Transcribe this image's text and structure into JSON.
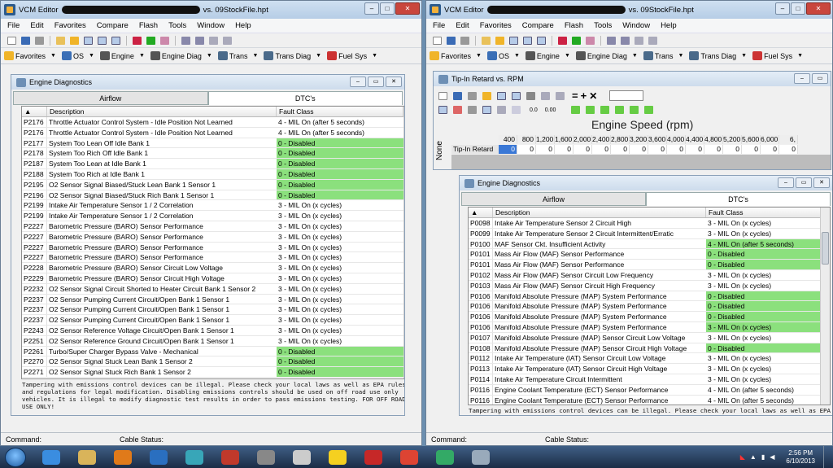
{
  "left": {
    "title_prefix": "VCM Editor",
    "title_suffix": "vs. 09StockFile.hpt",
    "menu": [
      "File",
      "Edit",
      "Favorites",
      "Compare",
      "Flash",
      "Tools",
      "Window",
      "Help"
    ],
    "nav": [
      {
        "label": "Favorites",
        "icon": "star-icon"
      },
      {
        "label": "OS",
        "icon": "chip-icon"
      },
      {
        "label": "Engine",
        "icon": "engine-icon"
      },
      {
        "label": "Engine Diag",
        "icon": "engine-icon"
      },
      {
        "label": "Trans",
        "icon": "gear-icon"
      },
      {
        "label": "Trans Diag",
        "icon": "gear-icon"
      },
      {
        "label": "Fuel Sys",
        "icon": "fuel-icon"
      }
    ],
    "diag": {
      "title": "Engine Diagnostics",
      "tabs": [
        "Airflow",
        "DTC's"
      ],
      "col_description": "Description",
      "col_fault": "Fault Class",
      "rows": [
        {
          "code": "P2176",
          "desc": "Throttle Actuator Control System - Idle Position Not Learned",
          "fault": "4 - MIL On (after 5 seconds)",
          "green": false
        },
        {
          "code": "P2176",
          "desc": "Throttle Actuator Control System - Idle Position Not Learned",
          "fault": "4 - MIL On (after 5 seconds)",
          "green": false
        },
        {
          "code": "P2177",
          "desc": "System Too Lean Off Idle Bank 1",
          "fault": "0 - Disabled",
          "green": true
        },
        {
          "code": "P2178",
          "desc": "System Too Rich Off Idle Bank 1",
          "fault": "0 - Disabled",
          "green": true
        },
        {
          "code": "P2187",
          "desc": "System Too Lean at Idle Bank 1",
          "fault": "0 - Disabled",
          "green": true
        },
        {
          "code": "P2188",
          "desc": "System Too Rich at Idle Bank 1",
          "fault": "0 - Disabled",
          "green": true
        },
        {
          "code": "P2195",
          "desc": "O2 Sensor Signal Biased/Stuck Lean Bank 1 Sensor 1",
          "fault": "0 - Disabled",
          "green": true
        },
        {
          "code": "P2196",
          "desc": "O2 Sensor Signal Biased/Stuck Rich Bank 1 Sensor 1",
          "fault": "0 - Disabled",
          "green": true
        },
        {
          "code": "P2199",
          "desc": "Intake Air Temperature Sensor 1 / 2 Correlation",
          "fault": "3 - MIL On (x cycles)",
          "green": false
        },
        {
          "code": "P2199",
          "desc": "Intake Air Temperature Sensor 1 / 2 Correlation",
          "fault": "3 - MIL On (x cycles)",
          "green": false
        },
        {
          "code": "P2227",
          "desc": "Barometric Pressure (BARO) Sensor Performance",
          "fault": "3 - MIL On (x cycles)",
          "green": false
        },
        {
          "code": "P2227",
          "desc": "Barometric Pressure (BARO) Sensor Performance",
          "fault": "3 - MIL On (x cycles)",
          "green": false
        },
        {
          "code": "P2227",
          "desc": "Barometric Pressure (BARO) Sensor Performance",
          "fault": "3 - MIL On (x cycles)",
          "green": false
        },
        {
          "code": "P2227",
          "desc": "Barometric Pressure (BARO) Sensor Performance",
          "fault": "3 - MIL On (x cycles)",
          "green": false
        },
        {
          "code": "P2228",
          "desc": "Barometric Pressure (BARO) Sensor Circuit Low Voltage",
          "fault": "3 - MIL On (x cycles)",
          "green": false
        },
        {
          "code": "P2229",
          "desc": "Barometric Pressure (BARO) Sensor Circuit High Voltage",
          "fault": "3 - MIL On (x cycles)",
          "green": false
        },
        {
          "code": "P2232",
          "desc": "O2 Sensor Signal Circuit Shorted to Heater Circuit Bank 1 Sensor 2",
          "fault": "3 - MIL On (x cycles)",
          "green": false
        },
        {
          "code": "P2237",
          "desc": "O2 Sensor Pumping Current Circuit/Open Bank 1 Sensor 1",
          "fault": "3 - MIL On (x cycles)",
          "green": false
        },
        {
          "code": "P2237",
          "desc": "O2 Sensor Pumping Current Circuit/Open Bank 1 Sensor 1",
          "fault": "3 - MIL On (x cycles)",
          "green": false
        },
        {
          "code": "P2237",
          "desc": "O2 Sensor Pumping Current Circuit/Open Bank 1 Sensor 1",
          "fault": "3 - MIL On (x cycles)",
          "green": false
        },
        {
          "code": "P2243",
          "desc": "O2 Sensor Reference Voltage Circuit/Open Bank 1 Sensor 1",
          "fault": "3 - MIL On (x cycles)",
          "green": false
        },
        {
          "code": "P2251",
          "desc": "O2 Sensor Reference Ground Circuit/Open Bank 1 Sensor 1",
          "fault": "3 - MIL On (x cycles)",
          "green": false
        },
        {
          "code": "P2261",
          "desc": "Turbo/Super Charger Bypass Valve - Mechanical",
          "fault": "0 - Disabled",
          "green": true
        },
        {
          "code": "P2270",
          "desc": "O2 Sensor Signal Stuck Lean Bank 1 Sensor 2",
          "fault": "0 - Disabled",
          "green": true
        },
        {
          "code": "P2271",
          "desc": "O2 Sensor Signal Stuck Rich Bank 1 Sensor 2",
          "fault": "0 - Disabled",
          "green": true
        }
      ]
    },
    "notice": "Tampering with emissions control devices can be illegal. Please check your local laws as well as EPA rules and regulations for legal modification. Disabling emissions controls should be used on off road use only vehicles. It is illegal to modify diagnostic test results in order to pass emissions testing. FOR OFF ROAD USE ONLY!",
    "status_command": "Command:",
    "status_cable": "Cable Status:"
  },
  "right": {
    "title_prefix": "VCM Editor",
    "title_suffix": "vs. 09StockFile.hpt",
    "menu": [
      "File",
      "Edit",
      "Favorites",
      "Compare",
      "Flash",
      "Tools",
      "Window",
      "Help"
    ],
    "nav": [
      {
        "label": "Favorites",
        "icon": "star-icon"
      },
      {
        "label": "OS",
        "icon": "chip-icon"
      },
      {
        "label": "Engine",
        "icon": "engine-icon"
      },
      {
        "label": "Engine Diag",
        "icon": "engine-icon"
      },
      {
        "label": "Trans",
        "icon": "gear-icon"
      },
      {
        "label": "Trans Diag",
        "icon": "gear-icon"
      },
      {
        "label": "Fuel Sys",
        "icon": "fuel-icon"
      }
    ],
    "tip": {
      "title": "Tip-In Retard vs. RPM",
      "axis_title": "Engine Speed (rpm)",
      "y_label": "None",
      "row_label": "Tip-In Retard",
      "rpm": [
        "400",
        "800",
        "1,200",
        "1,600",
        "2,000",
        "2,400",
        "2,800",
        "3,200",
        "3,600",
        "4,000",
        "4,400",
        "4,800",
        "5,200",
        "5,600",
        "6,000",
        "6,"
      ],
      "values": [
        "0",
        "0",
        "0",
        "0",
        "0",
        "0",
        "0",
        "0",
        "0",
        "0",
        "0",
        "0",
        "0",
        "0",
        "0",
        "0"
      ],
      "btn_a": "0.0\n0.0",
      "btn_b": "0.00\n0.00"
    },
    "diag": {
      "title": "Engine Diagnostics",
      "tabs": [
        "Airflow",
        "DTC's"
      ],
      "col_description": "Description",
      "col_fault": "Fault Class",
      "rows": [
        {
          "code": "P0098",
          "desc": "Intake Air Temperature Sensor 2 Circuit High",
          "fault": "3 - MIL On (x cycles)",
          "green": false
        },
        {
          "code": "P0099",
          "desc": "Intake Air Temperature Sensor 2 Circuit Intermittent/Erratic",
          "fault": "3 - MIL On (x cycles)",
          "green": false
        },
        {
          "code": "P0100",
          "desc": "MAF Sensor Ckt. Insufficient Activity",
          "fault": "4 - MIL On (after 5 seconds)",
          "green": true
        },
        {
          "code": "P0101",
          "desc": "Mass Air Flow (MAF) Sensor Performance",
          "fault": "0 - Disabled",
          "green": true
        },
        {
          "code": "P0101",
          "desc": "Mass Air Flow (MAF) Sensor Performance",
          "fault": "0 - Disabled",
          "green": true
        },
        {
          "code": "P0102",
          "desc": "Mass Air Flow (MAF) Sensor Circuit Low Frequency",
          "fault": "3 - MIL On (x cycles)",
          "green": false
        },
        {
          "code": "P0103",
          "desc": "Mass Air Flow (MAF) Sensor Circuit High Frequency",
          "fault": "3 - MIL On (x cycles)",
          "green": false
        },
        {
          "code": "P0106",
          "desc": "Manifold Absolute Pressure (MAP) System Performance",
          "fault": "0 - Disabled",
          "green": true
        },
        {
          "code": "P0106",
          "desc": "Manifold Absolute Pressure (MAP) System Performance",
          "fault": "0 - Disabled",
          "green": true
        },
        {
          "code": "P0106",
          "desc": "Manifold Absolute Pressure (MAP) System Performance",
          "fault": "0 - Disabled",
          "green": true
        },
        {
          "code": "P0106",
          "desc": "Manifold Absolute Pressure (MAP) System Performance",
          "fault": "3 - MIL On (x cycles)",
          "green": true
        },
        {
          "code": "P0107",
          "desc": "Manifold Absolute Pressure (MAP) Sensor Circuit Low Voltage",
          "fault": "3 - MIL On (x cycles)",
          "green": false
        },
        {
          "code": "P0108",
          "desc": "Manifold Absolute Pressure (MAP) Sensor Circuit High Voltage",
          "fault": "0 - Disabled",
          "green": true
        },
        {
          "code": "P0112",
          "desc": "Intake Air Temperature (IAT) Sensor Circuit Low Voltage",
          "fault": "3 - MIL On (x cycles)",
          "green": false
        },
        {
          "code": "P0113",
          "desc": "Intake Air Temperature (IAT) Sensor Circuit High Voltage",
          "fault": "3 - MIL On (x cycles)",
          "green": false
        },
        {
          "code": "P0114",
          "desc": "Intake Air Temperature Circuit Intermittent",
          "fault": "3 - MIL On (x cycles)",
          "green": false
        },
        {
          "code": "P0116",
          "desc": "Engine Coolant Temperature (ECT) Sensor Performance",
          "fault": "4 - MIL On (after 5 seconds)",
          "green": false
        },
        {
          "code": "P0116",
          "desc": "Engine Coolant Temperature (ECT) Sensor Performance",
          "fault": "4 - MIL On (after 5 seconds)",
          "green": false
        }
      ]
    },
    "notice": "Tampering with emissions control devices can be illegal. Please check your local laws as well as EPA",
    "status_command": "Command:",
    "status_cable": "Cable Status:"
  },
  "taskbar": {
    "apps": [
      "ie-icon",
      "explorer-icon",
      "media-player-icon",
      "checkmark-app-icon",
      "globe-app-icon",
      "acrobat-vcm-icon",
      "hp-icon",
      "wrench-icon",
      "lightning-icon",
      "pdf-icon",
      "car-app-icon",
      "dashboard-app-icon",
      "calculator-icon"
    ],
    "time": "2:56 PM",
    "date": "6/10/2013"
  }
}
